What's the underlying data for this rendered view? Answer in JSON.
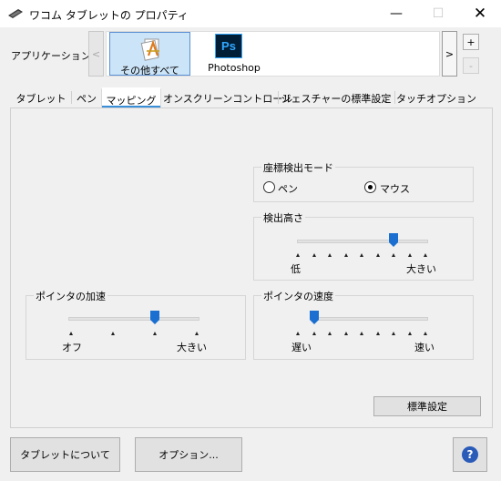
{
  "window": {
    "title": "ワコム タブレットの プロパティ",
    "min_glyph": "—",
    "max_glyph": "☐",
    "close_glyph": "✕"
  },
  "apps": {
    "label": "アプリケーション:",
    "scroll_left": "<",
    "scroll_right": ">",
    "add": "+",
    "remove": "-",
    "items": [
      {
        "label": "その他すべて",
        "icon": "all-apps-icon",
        "selected": true
      },
      {
        "label": "Photoshop",
        "icon_text": "Ps",
        "icon": "photoshop-icon"
      }
    ]
  },
  "tabs": [
    {
      "label": "タブレット"
    },
    {
      "label": "ペン"
    },
    {
      "label": "マッピング",
      "active": true
    },
    {
      "label": "オンスクリーンコントロール"
    },
    {
      "label": "ジェスチャーの標準設定"
    },
    {
      "label": "タッチオプション"
    }
  ],
  "coord_mode": {
    "title": "座標検出モード",
    "pen_label": "ペン",
    "mouse_label": "マウス",
    "selected": "mouse"
  },
  "detect_height": {
    "title": "検出高さ",
    "low_label": "低",
    "high_label": "大きい",
    "value": 0.75
  },
  "pointer_accel": {
    "title": "ポインタの加速",
    "low_label": "オフ",
    "high_label": "大きい",
    "value": 0.667
  },
  "pointer_speed": {
    "title": "ポインタの速度",
    "low_label": "遅い",
    "high_label": "速い",
    "value": 0.125
  },
  "buttons": {
    "default": "標準設定",
    "about": "タブレットについて",
    "options": "オプション...",
    "help_glyph": "?"
  },
  "colors": {
    "accent": "#3a8fd9",
    "thumb": "#1a6fd0",
    "selection": "#cce4f7"
  }
}
